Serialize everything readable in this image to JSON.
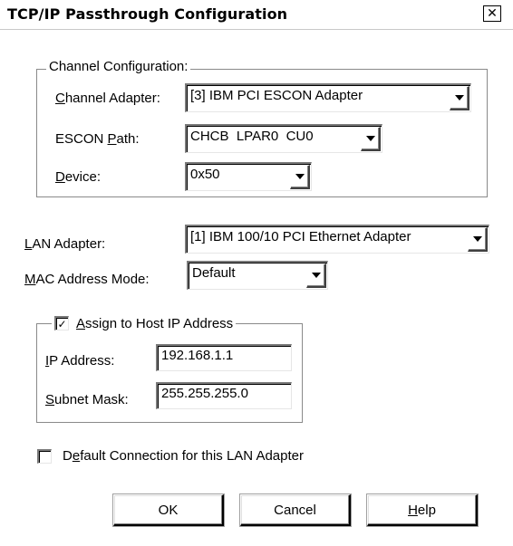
{
  "window": {
    "title": "TCP/IP Passthrough Configuration",
    "close_glyph": "✕",
    "close_icon": "close-icon"
  },
  "channel_group": {
    "legend": "Channel Configuration:",
    "channel_adapter": {
      "label_mnemonic": "C",
      "label_rest": "hannel Adapter:",
      "value": "[3] IBM PCI ESCON Adapter"
    },
    "escon_path": {
      "label_pre": "ESCON ",
      "label_mnemonic": "P",
      "label_rest": "ath:",
      "value": "CHCB  LPAR0  CU0"
    },
    "device": {
      "label_mnemonic": "D",
      "label_rest": "evice:",
      "value": "0x50"
    }
  },
  "lan_adapter": {
    "label_mnemonic": "L",
    "label_rest": "AN Adapter:",
    "value": "[1] IBM 100/10 PCI Ethernet Adapter"
  },
  "mac_mode": {
    "label_mnemonic": "M",
    "label_rest": "AC Address Mode:",
    "value": "Default"
  },
  "host_ip_group": {
    "checkbox_checked": true,
    "check_glyph": "✓",
    "legend_mnemonic": "A",
    "legend_rest": "ssign to Host IP Address",
    "ip_address": {
      "label_mnemonic": "I",
      "label_rest": "P Address:",
      "value": "192.168.1.1"
    },
    "subnet_mask": {
      "label_mnemonic": "S",
      "label_rest": "ubnet Mask:",
      "value": "255.255.255.0"
    }
  },
  "default_connection": {
    "checked": false,
    "label_pre": "D",
    "label_mnemonic": "e",
    "label_rest": "fault Connection for this LAN Adapter"
  },
  "buttons": {
    "ok": "OK",
    "cancel": "Cancel",
    "help_mnemonic": "H",
    "help_rest": "elp"
  },
  "icons": {
    "dropdown": "chevron-down-icon",
    "checkmark": "checkmark-icon"
  }
}
